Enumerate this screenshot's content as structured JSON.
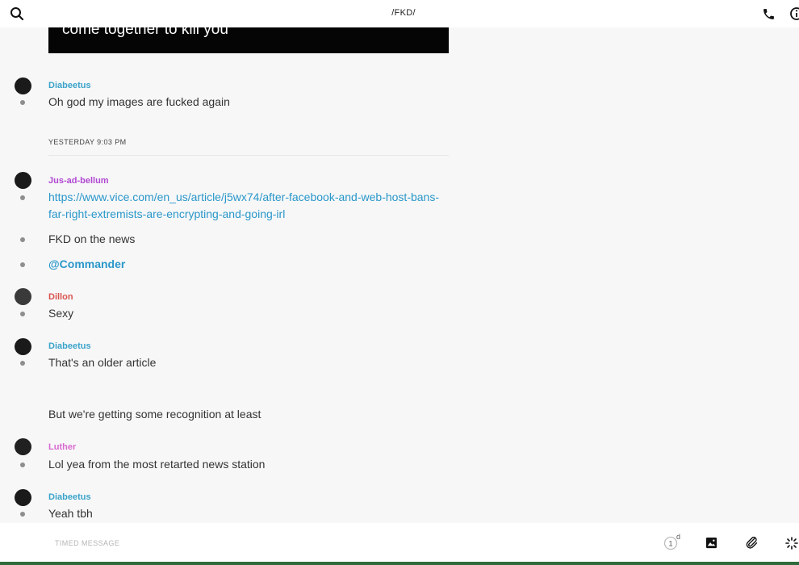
{
  "header": {
    "title": "/FKD/",
    "icons": [
      "search-icon",
      "phone-icon",
      "info-icon"
    ]
  },
  "image_caption": "come together to kill you",
  "messages": [
    {
      "author": "Diabeetus",
      "author_color": "#3ba3c9",
      "text": "Oh god my images are fucked again"
    },
    {
      "author": "Jus-ad-bellum",
      "author_color": "#b148d2",
      "link": "https://www.vice.com/en_us/article/j5wx74/after-facebook-and-web-host-bans-far-right-extremists-are-encrypting-and-going-irl",
      "followups": [
        "FKD on the news",
        "@Commander"
      ]
    },
    {
      "author": "Dillon",
      "author_color": "#d9534f",
      "text": "Sexy"
    },
    {
      "author": "Diabeetus",
      "author_color": "#3ba3c9",
      "text": "That's an older article",
      "followup": "But we're getting some recognition at least"
    },
    {
      "author": "Luther",
      "author_color": "#d86bd0",
      "text": "Lol yea from the most retarted news station"
    },
    {
      "author": "Diabeetus",
      "author_color": "#3ba3c9",
      "text": "Yeah tbh"
    }
  ],
  "day_separator": "YESTERDAY 9:03 PM",
  "composer": {
    "placeholder": "TIMED MESSAGE",
    "timer_value": "1",
    "timer_unit": "d"
  },
  "colors": {
    "accent": "#2a97c9",
    "background": "#f7f7f8"
  }
}
